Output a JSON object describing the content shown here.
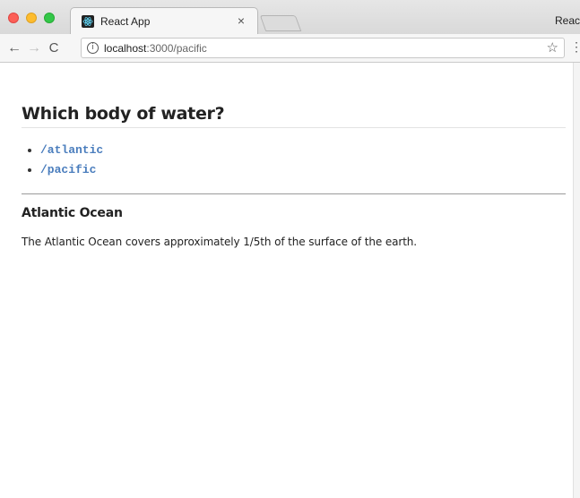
{
  "browser": {
    "tab_title": "React App",
    "tab_close": "×",
    "profile_text": "Reac",
    "url_host": "localhost",
    "url_path": ":3000/pacific",
    "info_glyph": "i",
    "back_glyph": "←",
    "forward_glyph": "→",
    "reload_glyph": "C",
    "star_glyph": "☆",
    "menu_glyph": "⋮",
    "icons": [
      "close-window-icon",
      "minimize-window-icon",
      "maximize-window-icon",
      "react-favicon-icon",
      "back-arrow-icon",
      "forward-arrow-icon",
      "reload-icon",
      "info-icon",
      "bookmark-star-icon",
      "menu-icon"
    ]
  },
  "page": {
    "title": "Which body of water?",
    "links": [
      {
        "label": "/atlantic"
      },
      {
        "label": "/pacific"
      }
    ],
    "section": {
      "heading": "Atlantic Ocean",
      "description": "The Atlantic Ocean covers approximately 1/5th of the surface of the earth."
    }
  },
  "colors": {
    "link": "#4a7dbd",
    "text": "#222222",
    "traffic_close": "#fc5f57",
    "traffic_min": "#fdbc2e",
    "traffic_max": "#33c748"
  }
}
